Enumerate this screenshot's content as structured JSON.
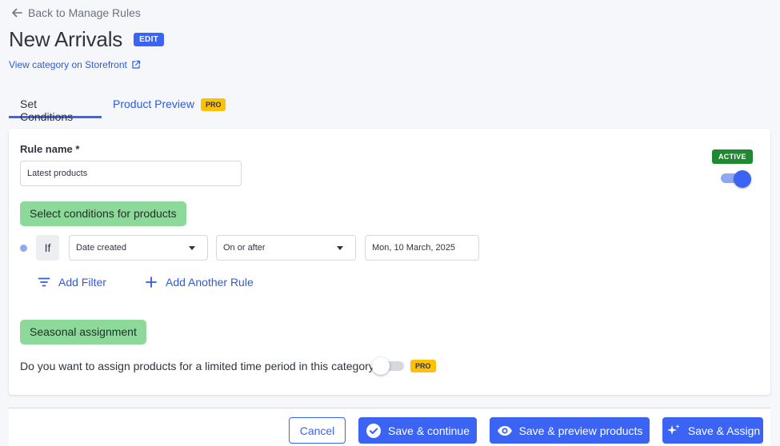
{
  "nav": {
    "back_label": "Back to Manage Rules"
  },
  "header": {
    "title": "New Arrivals",
    "edit_badge": "EDIT",
    "storefront_link": "View category on Storefront"
  },
  "tabs": [
    {
      "label": "Set Conditions",
      "active": true
    },
    {
      "label": "Product Preview",
      "badge": "PRO",
      "active": false
    }
  ],
  "rule": {
    "name_label": "Rule name *",
    "name_value": "Latest products",
    "status_badge": "ACTIVE",
    "active": true
  },
  "conditions": {
    "section_label": "Select conditions for products",
    "if_label": "If",
    "field_value": "Date created",
    "operator_value": "On or after",
    "date_value": "Mon, 10 March, 2025",
    "add_filter_label": "Add Filter",
    "add_rule_label": "Add Another Rule"
  },
  "seasonal": {
    "section_label": "Seasonal assignment",
    "question": "Do you want to assign products for a limited time period in this category?",
    "enabled": false,
    "badge": "PRO"
  },
  "footer": {
    "cancel_label": "Cancel",
    "save_continue_label": "Save & continue",
    "save_preview_label": "Save & preview products",
    "save_assign_label": "Save & Assign"
  },
  "colors": {
    "accent": "#3c64f4",
    "active_green": "#208831",
    "section_green": "#8dd99a",
    "pro_yellow": "#ffc107"
  }
}
